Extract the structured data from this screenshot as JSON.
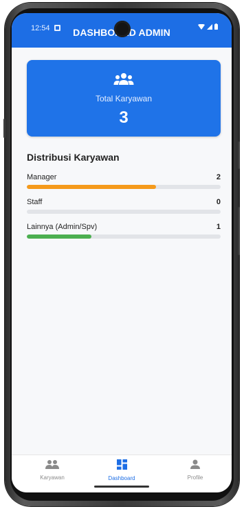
{
  "status_bar": {
    "time": "12:54"
  },
  "app_bar": {
    "title": "DASHBOARD ADMIN"
  },
  "summary": {
    "label": "Total Karyawan",
    "value": "3",
    "icon": "group-icon"
  },
  "distribution": {
    "title": "Distribusi Karyawan",
    "items": [
      {
        "name": "Manager",
        "count": "2",
        "fraction": 0.667,
        "color": "#f59a1b"
      },
      {
        "name": "Staff",
        "count": "0",
        "fraction": 0,
        "color": "#9e9e9e"
      },
      {
        "name": "Lainnya (Admin/Spv)",
        "count": "1",
        "fraction": 0.333,
        "color": "#4caf50"
      }
    ]
  },
  "bottom_nav": {
    "items": [
      {
        "label": "Karyawan",
        "icon": "people-icon",
        "active": false
      },
      {
        "label": "Dashboard",
        "icon": "dashboard-icon",
        "active": true
      },
      {
        "label": "Profile",
        "icon": "person-icon",
        "active": false
      }
    ],
    "active_color": "#1d6ee5",
    "inactive_color": "#8a8a8a"
  },
  "colors": {
    "primary": "#1d6ee5",
    "background": "#f7f8fa"
  }
}
